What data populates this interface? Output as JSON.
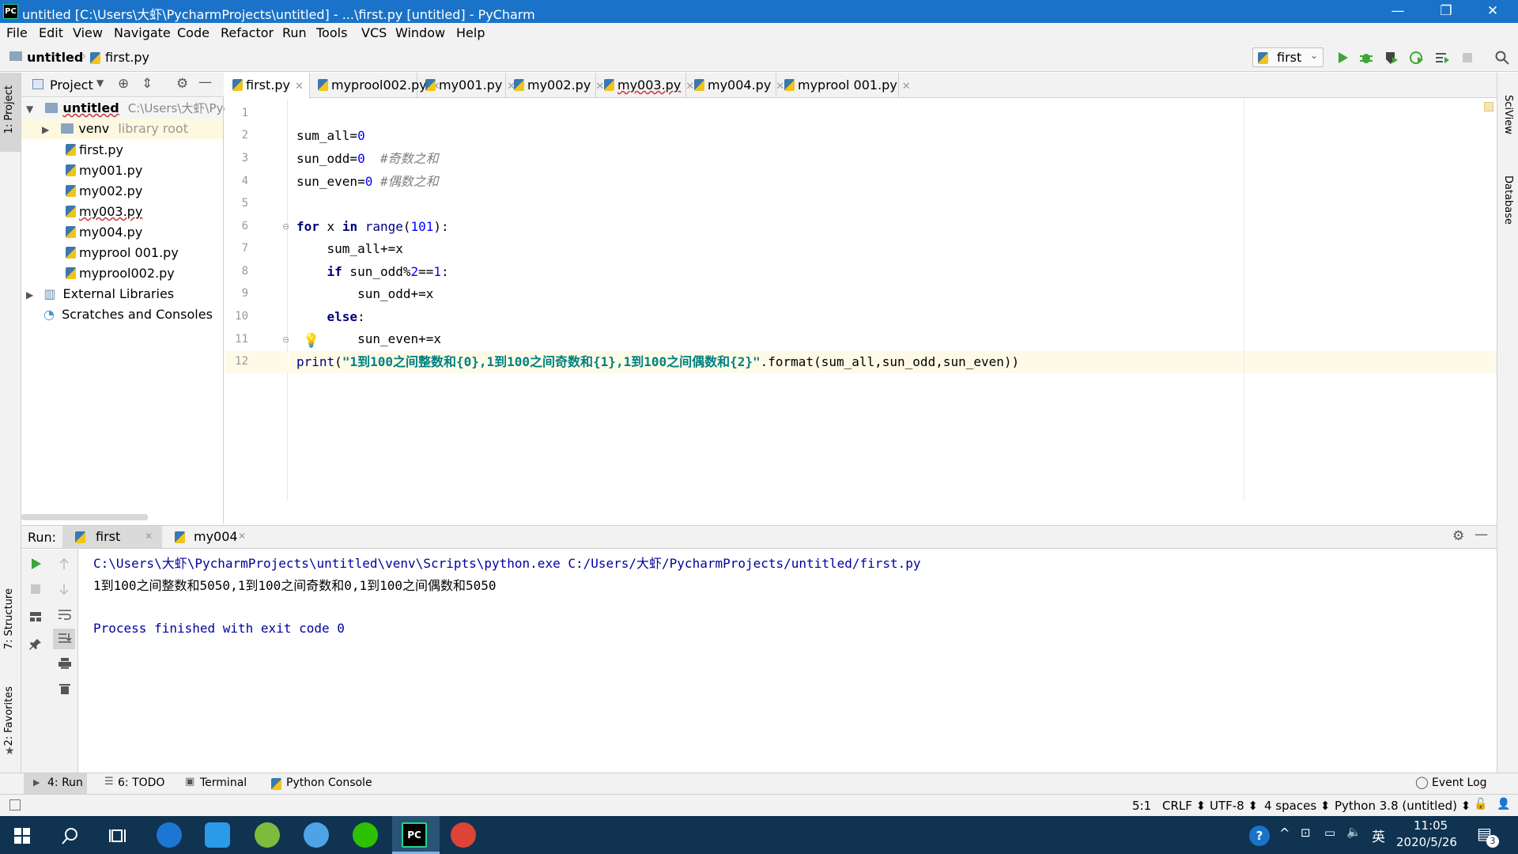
{
  "window": {
    "title": "untitled [C:\\Users\\大虾\\PycharmProjects\\untitled] - ...\\first.py [untitled] - PyCharm",
    "app_icon_text": "PC",
    "minimize": "—",
    "maximize": "❐",
    "close": "✕"
  },
  "menu": [
    "File",
    "Edit",
    "View",
    "Navigate",
    "Code",
    "Refactor",
    "Run",
    "Tools",
    "VCS",
    "Window",
    "Help"
  ],
  "nav": {
    "project": "untitled",
    "file": "first.py",
    "run_config": "first"
  },
  "left_strip": {
    "project": "1: Project",
    "structure": "7: Structure",
    "favorites": "2: Favorites"
  },
  "right_strip": {
    "sciview": "SciView",
    "database": "Database"
  },
  "project_panel": {
    "title": "Project",
    "root_name": "untitled",
    "root_path": "C:\\Users\\大虾\\Pycharm",
    "venv": "venv",
    "venv_note": "library root",
    "files": [
      "first.py",
      "my001.py",
      "my002.py",
      "my003.py",
      "my004.py",
      "myprool 001.py",
      "myprool002.py"
    ],
    "external": "External Libraries",
    "scratches": "Scratches and Consoles"
  },
  "editor_tabs": [
    "first.py",
    "myprool002.py",
    "my001.py",
    "my002.py",
    "my003.py",
    "my004.py",
    "myprool 001.py"
  ],
  "line_numbers": [
    "1",
    "2",
    "3",
    "4",
    "5",
    "6",
    "7",
    "8",
    "9",
    "10",
    "11",
    "12"
  ],
  "code": {
    "l2a": "sum_all=",
    "l2b": "0",
    "l3a": "sun_odd=",
    "l3b": "0",
    "l3c": "  #奇数之和",
    "l4a": "sun_even=",
    "l4b": "0",
    "l4c": " #偶数之和",
    "l6a": "for",
    "l6b": " x ",
    "l6c": "in",
    "l6d": " range",
    "l6e": "(",
    "l6f": "101",
    "l6g": "):",
    "l7": "    sum_all+=x",
    "l8a": "    ",
    "l8b": "if",
    "l8c": " sun_odd%",
    "l8d": "2",
    "l8e": "==",
    "l8f": "1",
    "l8g": ":",
    "l9": "        sun_odd+=x",
    "l10a": "    ",
    "l10b": "else",
    "l10c": ":",
    "l11": "        sun_even+=x",
    "l12a": "print",
    "l12b": "(",
    "l12c": "\"1到100之间整数和{0},1到100之间奇数和{1},1到100之间偶数和{2}\"",
    "l12d": ".format(sum_all,sun_odd,sun_even))"
  },
  "run_panel": {
    "label": "Run:",
    "tabs": [
      "first",
      "my004"
    ],
    "cmd": "C:\\Users\\大虾\\PycharmProjects\\untitled\\venv\\Scripts\\python.exe C:/Users/大虾/PycharmProjects/untitled/first.py",
    "output": "1到100之间整数和5050,1到100之间奇数和0,1到100之间偶数和5050",
    "exit": "Process finished with exit code 0"
  },
  "bottom_tools": [
    "4: Run",
    "6: TODO",
    "Terminal",
    "Python Console"
  ],
  "event_log": "Event Log",
  "status": {
    "position": "5:1",
    "line_sep": "CRLF ⬍",
    "encoding": "UTF-8 ⬍",
    "indent": "4 spaces ⬍",
    "interpreter": "Python 3.8 (untitled) ⬍"
  },
  "taskbar": {
    "ime": "英",
    "time": "11:05",
    "date": "2020/5/26",
    "notif_count": "3"
  },
  "colors": {
    "titlebar": "#1a73c8",
    "keyword": "#000080",
    "number": "#0000ff",
    "string": "#008080",
    "comment": "#808080",
    "console_blue": "#0000a0",
    "run_green": "#3da638"
  }
}
